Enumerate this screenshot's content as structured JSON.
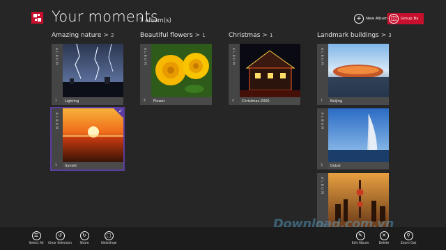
{
  "header": {
    "title": "Your moments",
    "album_count": "7 album(s)",
    "new_album_label": "New Album",
    "group_by_label": "Group By"
  },
  "groups": [
    {
      "name": "Amazing nature",
      "chevron": ">",
      "count": "2"
    },
    {
      "name": "Beautiful flowers",
      "chevron": ">",
      "count": "1"
    },
    {
      "name": "Christmas",
      "chevron": ">",
      "count": "1"
    },
    {
      "name": "Landmark buildings",
      "chevron": ">",
      "count": "3"
    }
  ],
  "albums": [
    {
      "label": "ALBUM",
      "count": "1",
      "caption": "Lighting",
      "icon": "lightning-photo"
    },
    {
      "label": "ALBUM",
      "count": "1",
      "caption": "Sunset",
      "icon": "sunset-photo",
      "selected": true
    },
    {
      "label": "ALBUM",
      "count": "4",
      "caption": "Flower",
      "icon": "rose-photo"
    },
    {
      "label": "ALBUM",
      "count": "4",
      "caption": "Christmas-2005",
      "icon": "christmas-house-photo"
    },
    {
      "label": "ALBUM",
      "count": "7",
      "caption": "Beijing",
      "icon": "stadium-photo"
    },
    {
      "label": "ALBUM",
      "count": "3",
      "caption": "Dubai",
      "icon": "hotel-tower-photo"
    },
    {
      "label": "ALBUM",
      "count": "",
      "caption": "",
      "icon": "shanghai-skyline-photo"
    }
  ],
  "appbar": {
    "left": [
      {
        "label": "Select All",
        "icon": "select-all-icon"
      },
      {
        "label": "Clear Selection",
        "icon": "clear-selection-icon"
      },
      {
        "label": "Share",
        "icon": "share-icon"
      },
      {
        "label": "Slideshow",
        "icon": "slideshow-icon"
      }
    ],
    "right": [
      {
        "label": "Edit Album",
        "icon": "edit-icon"
      },
      {
        "label": "Delete",
        "icon": "delete-icon"
      },
      {
        "label": "Zoom Out",
        "icon": "zoom-out-icon"
      }
    ]
  },
  "watermark": "Download.com.vn",
  "colors": {
    "accent": "#c8102e",
    "selection": "#5b3da1",
    "background": "#262626"
  }
}
